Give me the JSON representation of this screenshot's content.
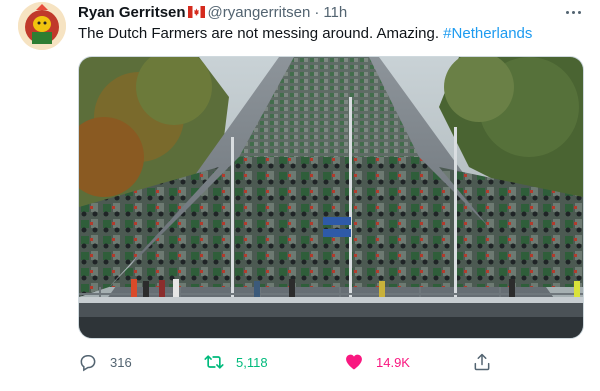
{
  "tweet": {
    "author": {
      "name": "Ryan Gerritsen",
      "flag": "canada-flag-emoji",
      "handle": "@ryangerritsen",
      "separator": "·",
      "time": "11h"
    },
    "text": {
      "body": "The Dutch Farmers are not messing around. Amazing. ",
      "hashtag": "#Netherlands"
    },
    "media": {
      "image": "photo of a highway filled with tractors"
    },
    "actions": {
      "reply": {
        "icon": "reply-icon",
        "count": "316"
      },
      "retweet": {
        "icon": "retweet-icon",
        "count": "5,118",
        "active": true,
        "color": "#00ba7c"
      },
      "like": {
        "icon": "heart-icon",
        "count": "14.9K",
        "active": true,
        "color": "#f91880"
      },
      "share": {
        "icon": "share-icon"
      }
    },
    "colors": {
      "link": "#1d9bf0",
      "secondary_text": "#536471",
      "primary_text": "#0f1419"
    }
  }
}
